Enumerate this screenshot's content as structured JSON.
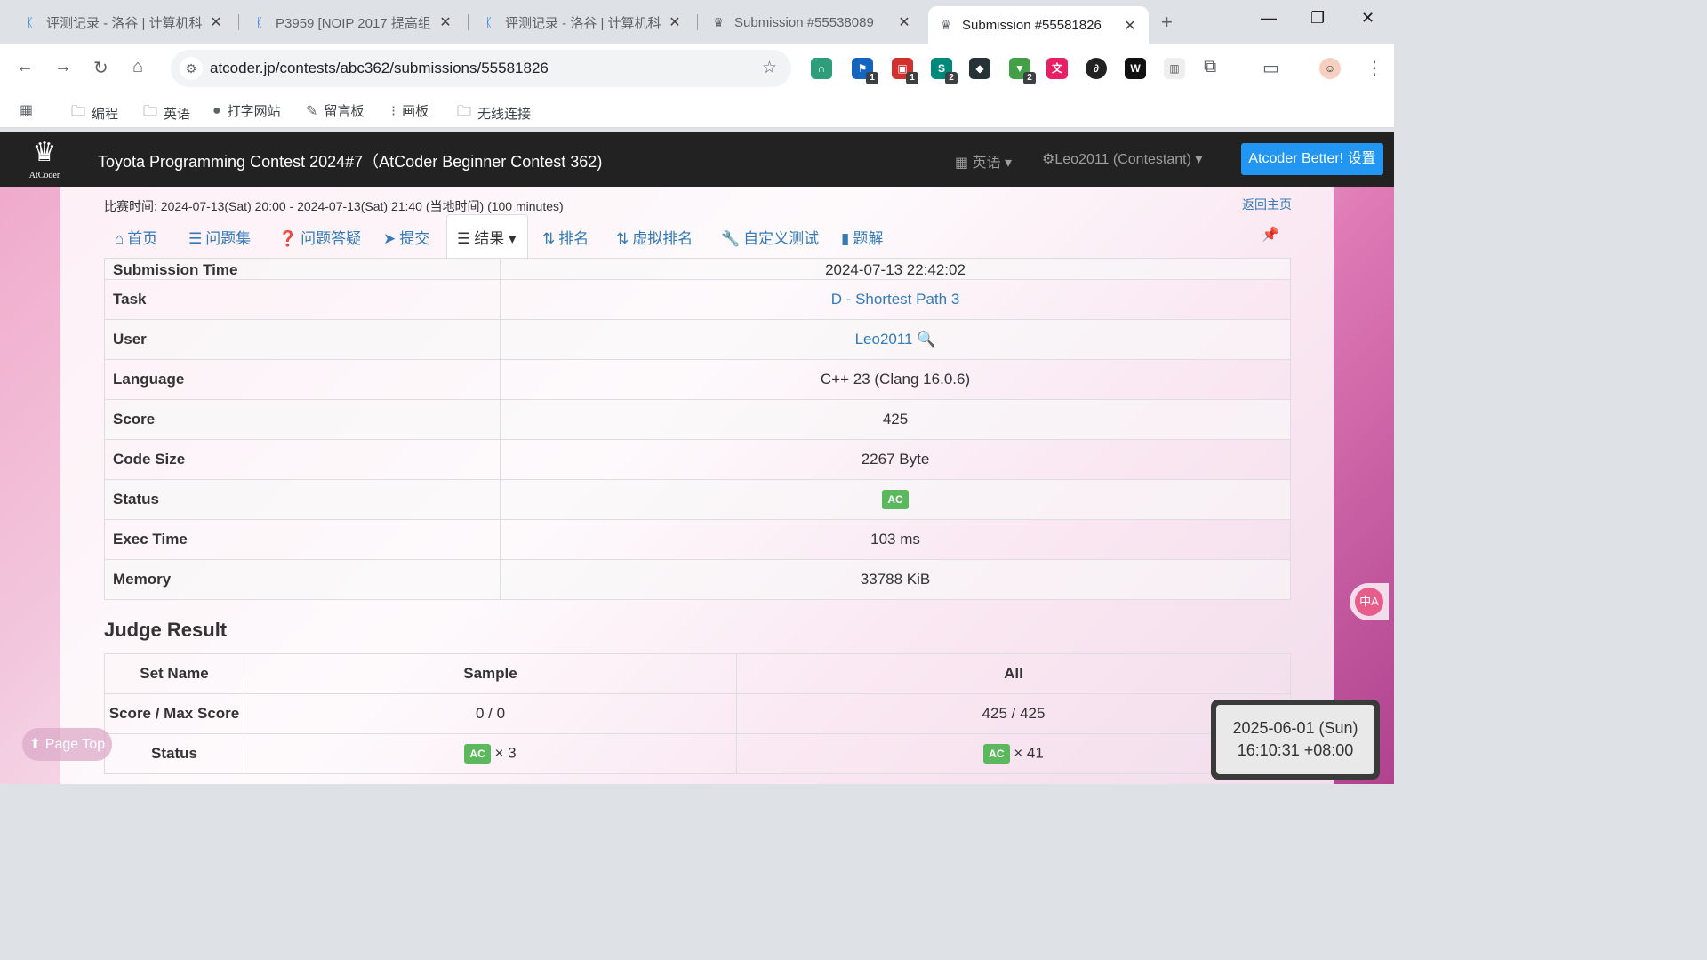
{
  "browser": {
    "tabs": [
      {
        "title": "评测记录 - 洛谷 | 计算机科",
        "icon": "luogu-icon"
      },
      {
        "title": "P3959 [NOIP 2017 提高组",
        "icon": "luogu-icon"
      },
      {
        "title": "评测记录 - 洛谷 | 计算机科",
        "icon": "luogu-icon"
      },
      {
        "title": "Submission #55538089",
        "icon": "atcoder-icon"
      },
      {
        "title": "Submission #55581826",
        "icon": "atcoder-icon"
      }
    ],
    "url": "atcoder.jp/contests/abc362/submissions/55581826",
    "extension_badges": [
      "1",
      "1",
      "2",
      "2"
    ],
    "bookmarks": [
      "编程",
      "英语",
      "打字网站",
      "留言板",
      "画板",
      "无线连接"
    ]
  },
  "header": {
    "logo_text": "AtCoder",
    "contest_title": "Toyota Programming Contest 2024#7（AtCoder Beginner Contest 362)",
    "language": "英语",
    "user": "Leo2011 (Contestant)",
    "better_button": "Atcoder Better! 设置"
  },
  "contest_time": "比赛时间: 2024-07-13(Sat) 20:00 - 2024-07-13(Sat) 21:40 (当地时间) (100 minutes)",
  "back_home": "返回主页",
  "subnav": [
    {
      "label": "首页",
      "icon": "home-icon"
    },
    {
      "label": "问题集",
      "icon": "list-icon"
    },
    {
      "label": "问题答疑",
      "icon": "question-icon"
    },
    {
      "label": "提交",
      "icon": "send-icon"
    },
    {
      "label": "结果",
      "icon": "results-icon"
    },
    {
      "label": "排名",
      "icon": "sort-icon"
    },
    {
      "label": "虚拟排名",
      "icon": "sort-icon"
    },
    {
      "label": "自定义测试",
      "icon": "wrench-icon"
    },
    {
      "label": "题解",
      "icon": "book-icon"
    }
  ],
  "submission": {
    "cut_row": {
      "key": "Submission Time",
      "value": "2024-07-13 22:42:02"
    },
    "rows": [
      {
        "key": "Task",
        "value": "D - Shortest Path 3",
        "link": true
      },
      {
        "key": "User",
        "value": "Leo2011",
        "link": true
      },
      {
        "key": "Language",
        "value": "C++ 23 (Clang 16.0.6)"
      },
      {
        "key": "Score",
        "value": "425"
      },
      {
        "key": "Code Size",
        "value": "2267 Byte"
      },
      {
        "key": "Status",
        "value": "AC",
        "badge": true
      },
      {
        "key": "Exec Time",
        "value": "103 ms"
      },
      {
        "key": "Memory",
        "value": "33788 KiB"
      }
    ]
  },
  "judge": {
    "heading": "Judge Result",
    "headers": [
      "Set Name",
      "Sample",
      "All"
    ],
    "score_label": "Score / Max Score",
    "score_sample": "0 / 0",
    "score_all": "425 / 425",
    "status_label": "Status",
    "status_badge": "AC",
    "status_sample_count": "× 3",
    "status_all_count": "× 41"
  },
  "page_top": "Page Top",
  "clock": {
    "date": "2025-06-01 (Sun)",
    "time": "16:10:31 +08:00"
  },
  "translate_fab": "中A"
}
